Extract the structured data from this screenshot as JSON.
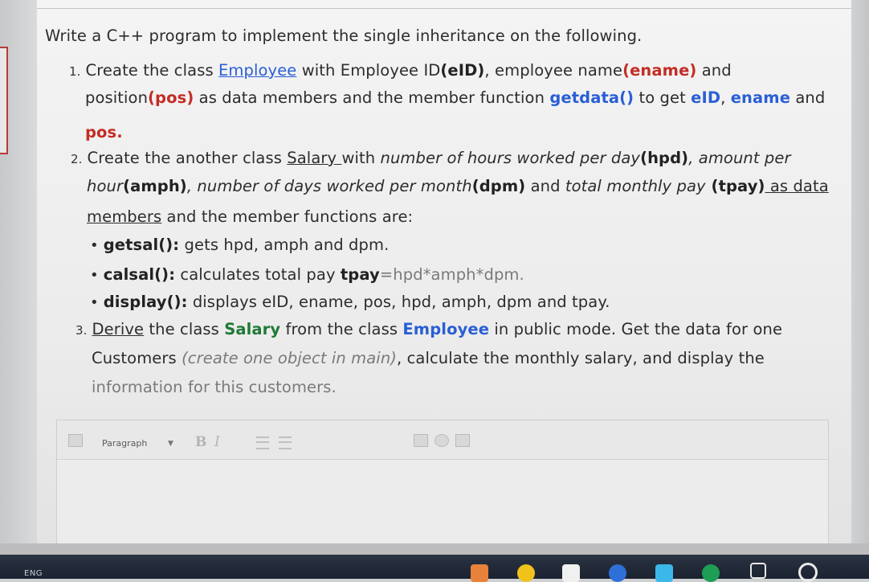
{
  "question": {
    "intro": "Write a C++ program to implement the single inheritance on the following.",
    "item1": {
      "num": "1.",
      "p1": "Create the class ",
      "class_name": "Employee",
      "p2": " with Employee ID",
      "eid": "(eID)",
      "p3": ", employee name",
      "ename": "(ename)",
      "p4": " and",
      "l2a": "position",
      "pos": "(pos)",
      "l2b": " as data members and the member function ",
      "fn": "getdata()",
      "l2c": " to get ",
      "eid2": "eID",
      "comma1": ", ",
      "ename2": "ename",
      "and1": " and",
      "l3": "pos."
    },
    "item2": {
      "num": "2.",
      "p1": "Create the another class ",
      "class_name": "Salary ",
      "p2": "with ",
      "p3": "number of hours worked per day",
      "hpd": "(hpd)",
      "p4": ", amount per",
      "l2a": "hour",
      "amph": "(amph)",
      "l2b": ", number of days worked per month",
      "dpm": "(dpm)",
      "l2c": " and ",
      "l2d": "total monthly pay",
      "tpay": " (tpay)",
      "l2e": " as data",
      "l3a": "members",
      "l3b": " and the member functions are:",
      "b1_name": "getsal():",
      "b1_text": " gets hpd, amph and dpm.",
      "b2_name": "calsal():",
      "b2_text": " calculates total pay ",
      "b2_formula_bold": "tpay",
      "b2_formula": "=hpd*amph*dpm.",
      "b3_name": "display():",
      "b3_text": " displays eID, ename, pos, hpd, amph, dpm and tpay."
    },
    "item3": {
      "num": "3.",
      "derive": "Derive",
      "p1": " the class ",
      "salary": "Salary",
      "p2": " from the class ",
      "employee": "Employee",
      "p3": " in public mode. Get the data for one",
      "l2a": "Customers ",
      "l2b": "(create one object in main)",
      "l2c": ", calculate the monthly salary, and display the",
      "l3": "information for this customers."
    }
  },
  "editor": {
    "paragraph_label": "Paragraph",
    "bold_label": "B",
    "italic_label": "I"
  },
  "taskbar": {
    "lang": "ENG"
  },
  "colors": {
    "accent_blue": "#2a5fd4",
    "accent_red": "#c42d24",
    "accent_green": "#1f7a38"
  }
}
